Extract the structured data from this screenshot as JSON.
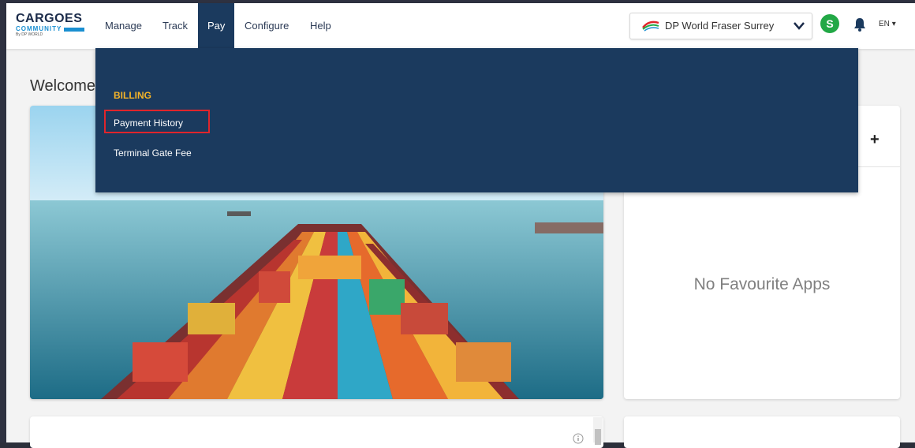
{
  "logo": {
    "line1": "CARGOES",
    "line2": "COMMUNITY",
    "line3": "By DP WORLD"
  },
  "nav": [
    {
      "label": "Manage"
    },
    {
      "label": "Track"
    },
    {
      "label": "Pay"
    },
    {
      "label": "Configure"
    },
    {
      "label": "Help"
    }
  ],
  "site_select": {
    "value": "DP World Fraser Surrey"
  },
  "user": {
    "initial": "S"
  },
  "language": "EN",
  "page": {
    "welcome": "Welcome"
  },
  "favourites": {
    "add_label": "+",
    "empty_text": "No Favourite Apps"
  },
  "pay_menu": {
    "section": "BILLING",
    "items": [
      "Payment History",
      "Terminal Gate Fee"
    ]
  },
  "colors": {
    "nav_active": "#1b3a5e",
    "menu_bg": "#1b3a5e",
    "section_heading": "#f5b428",
    "avatar": "#22a846",
    "highlight": "#e0252b"
  }
}
